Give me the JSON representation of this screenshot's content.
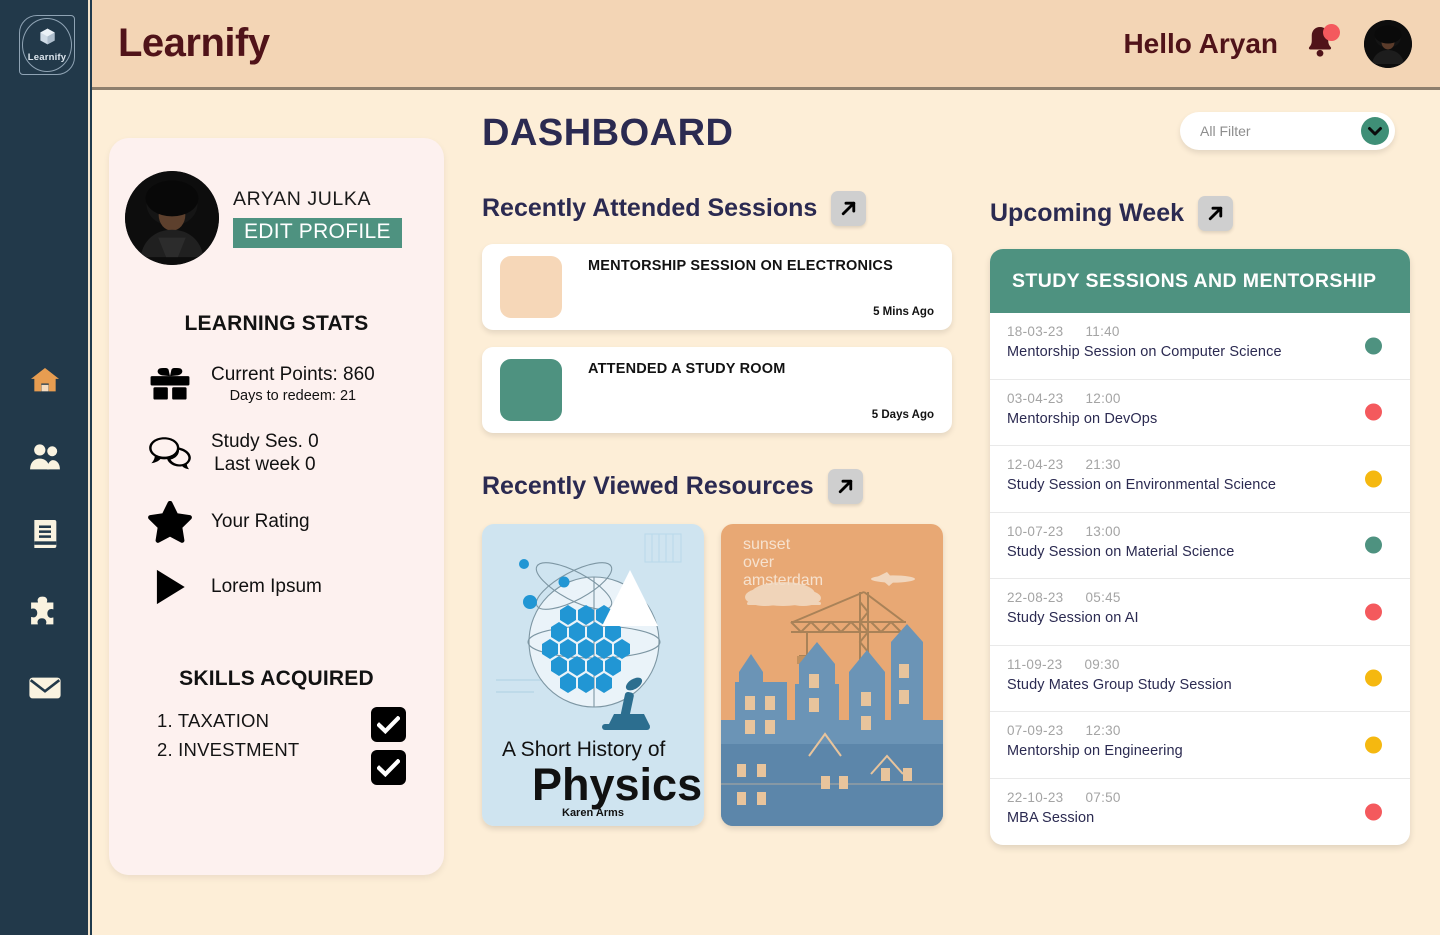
{
  "brand": {
    "name": "Learnify",
    "badge_text": "Learnify",
    "badge_icon": "cube-icon"
  },
  "topbar": {
    "greeting": "Hello Aryan",
    "bell_icon": "notification-bell-icon",
    "avatar_icon": "user-avatar",
    "bg_color": "#f3d5b5",
    "text_color": "#501319",
    "badge_color": "#f4595d"
  },
  "sidebar": {
    "bg_color": "#22394a",
    "items": [
      {
        "name": "home",
        "icon": "home-icon",
        "color": "#e79d51"
      },
      {
        "name": "community",
        "icon": "people-icon",
        "color": "#faf3e0"
      },
      {
        "name": "library",
        "icon": "book-icon",
        "color": "#faf3e0"
      },
      {
        "name": "puzzle",
        "icon": "puzzle-icon",
        "color": "#faf3e0"
      },
      {
        "name": "messages",
        "icon": "envelope-icon",
        "color": "#faf3e0"
      }
    ]
  },
  "profile": {
    "name": "ARYAN JULKA",
    "edit_label": "EDIT PROFILE",
    "edit_color": "#4e9280",
    "stats_title": "LEARNING STATS",
    "stats": [
      {
        "icon": "gift-icon",
        "main": "Current Points: 860",
        "sub": "Days to redeem: 21"
      },
      {
        "icon": "chat-bubbles-icon",
        "main": "Study Ses. 0",
        "sub": "Last week 0"
      },
      {
        "icon": "star-icon",
        "main": "Your Rating",
        "sub": ""
      },
      {
        "icon": "play-icon",
        "main": "Lorem Ipsum",
        "sub": ""
      }
    ],
    "skills_title": "SKILLS ACQUIRED",
    "skills": [
      "1. TAXATION",
      "2. INVESTMENT"
    ],
    "card_color": "#fdf1ef"
  },
  "main": {
    "page_title": "DASHBOARD",
    "sections": {
      "attended": {
        "heading": "Recently Attended Sessions",
        "expand_icon": "expand-arrow-icon",
        "items": [
          {
            "title": "MENTORSHIP SESSION ON ELECTRONICS",
            "time": "5 Mins Ago",
            "thumb_color": "#f6d7b8"
          },
          {
            "title": "ATTENDED A STUDY ROOM",
            "time": "5 Days Ago",
            "thumb_color": "#4e9280"
          }
        ]
      },
      "resources": {
        "heading": "Recently Viewed Resources",
        "expand_icon": "expand-arrow-icon",
        "items": [
          {
            "name": "physics-book-cover",
            "title_line1": "A Short History of",
            "title_line2": "Physics",
            "author": "Karen Arms",
            "bg_color": "#cfe4f0"
          },
          {
            "name": "amsterdam-book-cover",
            "title_line1": "sunset",
            "title_line2": "over",
            "title_line3": "amsterdam",
            "bg_color": "#e8a874"
          }
        ]
      }
    }
  },
  "filter": {
    "label": "All Filter",
    "chevron_icon": "chevron-down-icon",
    "accent": "#3f8f77"
  },
  "upcoming": {
    "heading": "Upcoming Week",
    "expand_icon": "expand-arrow-icon",
    "panel_title": "STUDY SESSIONS AND MENTORSHIP",
    "panel_header_color": "#4e9280",
    "status_colors": {
      "green": "#4e9280",
      "red": "#f4595d",
      "yellow": "#f5b810"
    },
    "rows": [
      {
        "date": "18-03-23",
        "time": "11:40",
        "title": "Mentorship Session on Computer Science",
        "status": "green"
      },
      {
        "date": "03-04-23",
        "time": "12:00",
        "title": "Mentorship on DevOps",
        "status": "red"
      },
      {
        "date": "12-04-23",
        "time": "21:30",
        "title": "Study Session on Environmental Science",
        "status": "yellow"
      },
      {
        "date": "10-07-23",
        "time": "13:00",
        "title": "Study Session on Material Science",
        "status": "green"
      },
      {
        "date": "22-08-23",
        "time": "05:45",
        "title": "Study Session on  AI",
        "status": "red"
      },
      {
        "date": "11-09-23",
        "time": "09:30",
        "title": "Study Mates Group Study Session",
        "status": "yellow"
      },
      {
        "date": "07-09-23",
        "time": "12:30",
        "title": "Mentorship on Engineering",
        "status": "yellow"
      },
      {
        "date": "22-10-23",
        "time": "07:50",
        "title": "MBA Session",
        "status": "red"
      }
    ]
  }
}
